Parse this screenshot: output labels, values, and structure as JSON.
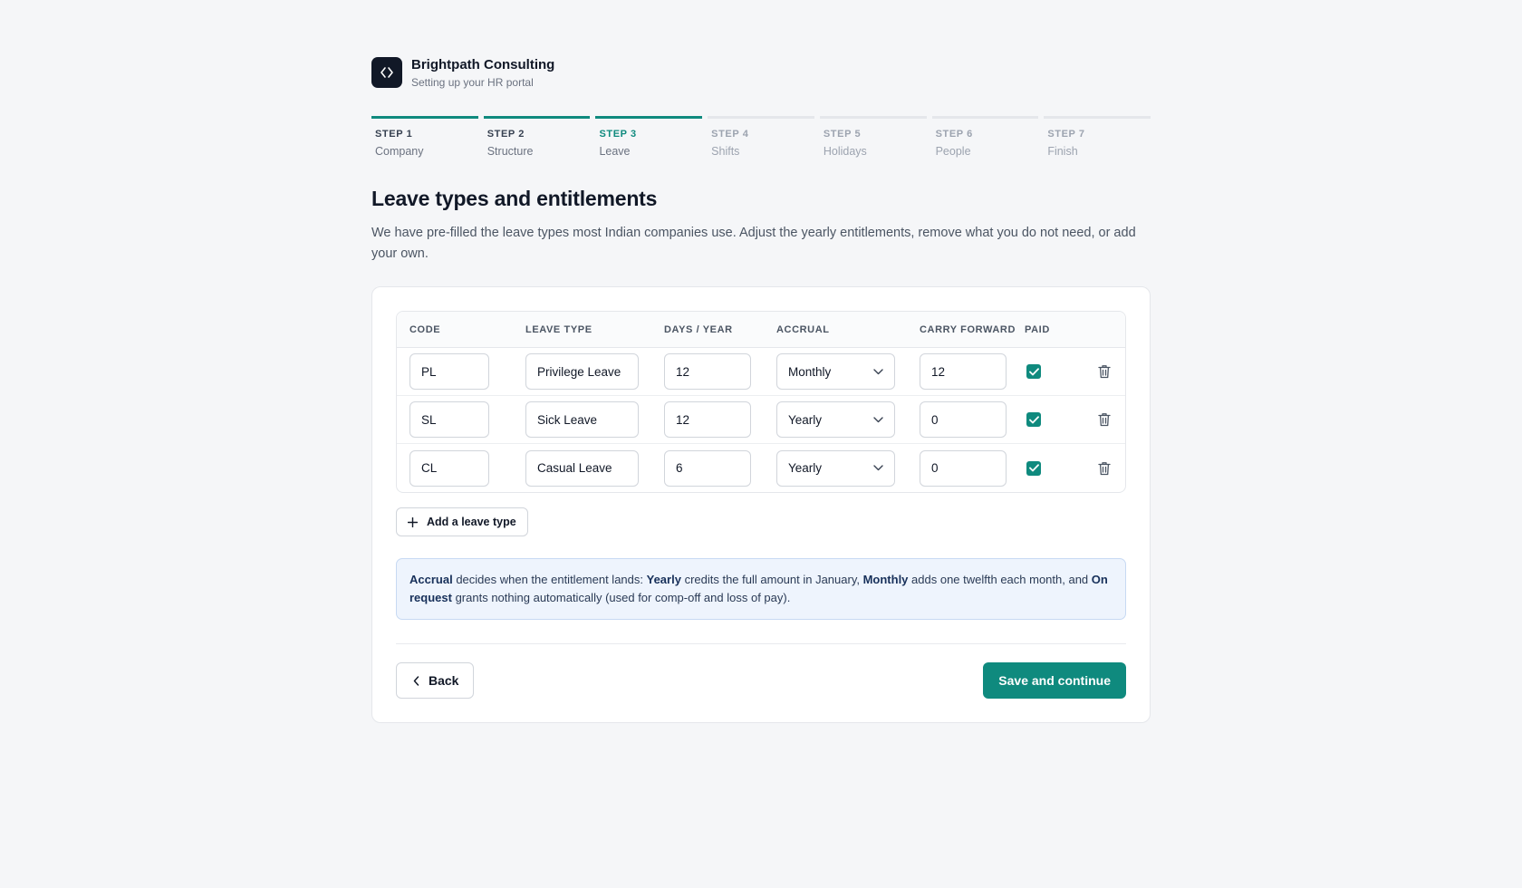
{
  "brand": {
    "name": "Brightpath Consulting",
    "subtitle": "Setting up your HR portal"
  },
  "steps": [
    {
      "number": "STEP 1",
      "label": "Company",
      "status": "done"
    },
    {
      "number": "STEP 2",
      "label": "Structure",
      "status": "done"
    },
    {
      "number": "STEP 3",
      "label": "Leave",
      "status": "current"
    },
    {
      "number": "STEP 4",
      "label": "Shifts",
      "status": "upcoming"
    },
    {
      "number": "STEP 5",
      "label": "Holidays",
      "status": "upcoming"
    },
    {
      "number": "STEP 6",
      "label": "People",
      "status": "upcoming"
    },
    {
      "number": "STEP 7",
      "label": "Finish",
      "status": "upcoming"
    }
  ],
  "heading": "Leave types and entitlements",
  "description": "We have pre-filled the leave types most Indian companies use. Adjust the yearly entitlements, remove what you do not need, or add your own.",
  "table": {
    "headers": {
      "code": "CODE",
      "type": "LEAVE TYPE",
      "days": "DAYS / YEAR",
      "accrual": "ACCRUAL",
      "carry": "CARRY FORWARD",
      "paid": "PAID"
    },
    "rows": [
      {
        "code": "PL",
        "type": "Privilege Leave",
        "days": "12",
        "accrual": "Monthly",
        "carry": "12",
        "paid": true
      },
      {
        "code": "SL",
        "type": "Sick Leave",
        "days": "12",
        "accrual": "Yearly",
        "carry": "0",
        "paid": true
      },
      {
        "code": "CL",
        "type": "Casual Leave",
        "days": "6",
        "accrual": "Yearly",
        "carry": "0",
        "paid": true
      }
    ]
  },
  "add_button": "Add a leave type",
  "info": {
    "t1": "Accrual",
    "t2": " decides when the entitlement lands: ",
    "t3": "Yearly",
    "t4": " credits the full amount in January, ",
    "t5": "Monthly",
    "t6": " adds one twelfth each month, and ",
    "t7": "On request",
    "t8": " grants nothing automatically (used for comp-off and loss of pay)."
  },
  "footer": {
    "back": "Back",
    "save": "Save and continue"
  },
  "colors": {
    "accent": "#0f8a7e",
    "info_bg": "#eef4fd",
    "logo_bg": "#111827"
  },
  "icons": {
    "logo": "code-brackets-icon",
    "dropdown": "chevron-down-icon",
    "delete": "trash-icon",
    "add": "plus-icon",
    "back": "chevron-left-icon",
    "paid": "checkbox-checked-icon"
  }
}
